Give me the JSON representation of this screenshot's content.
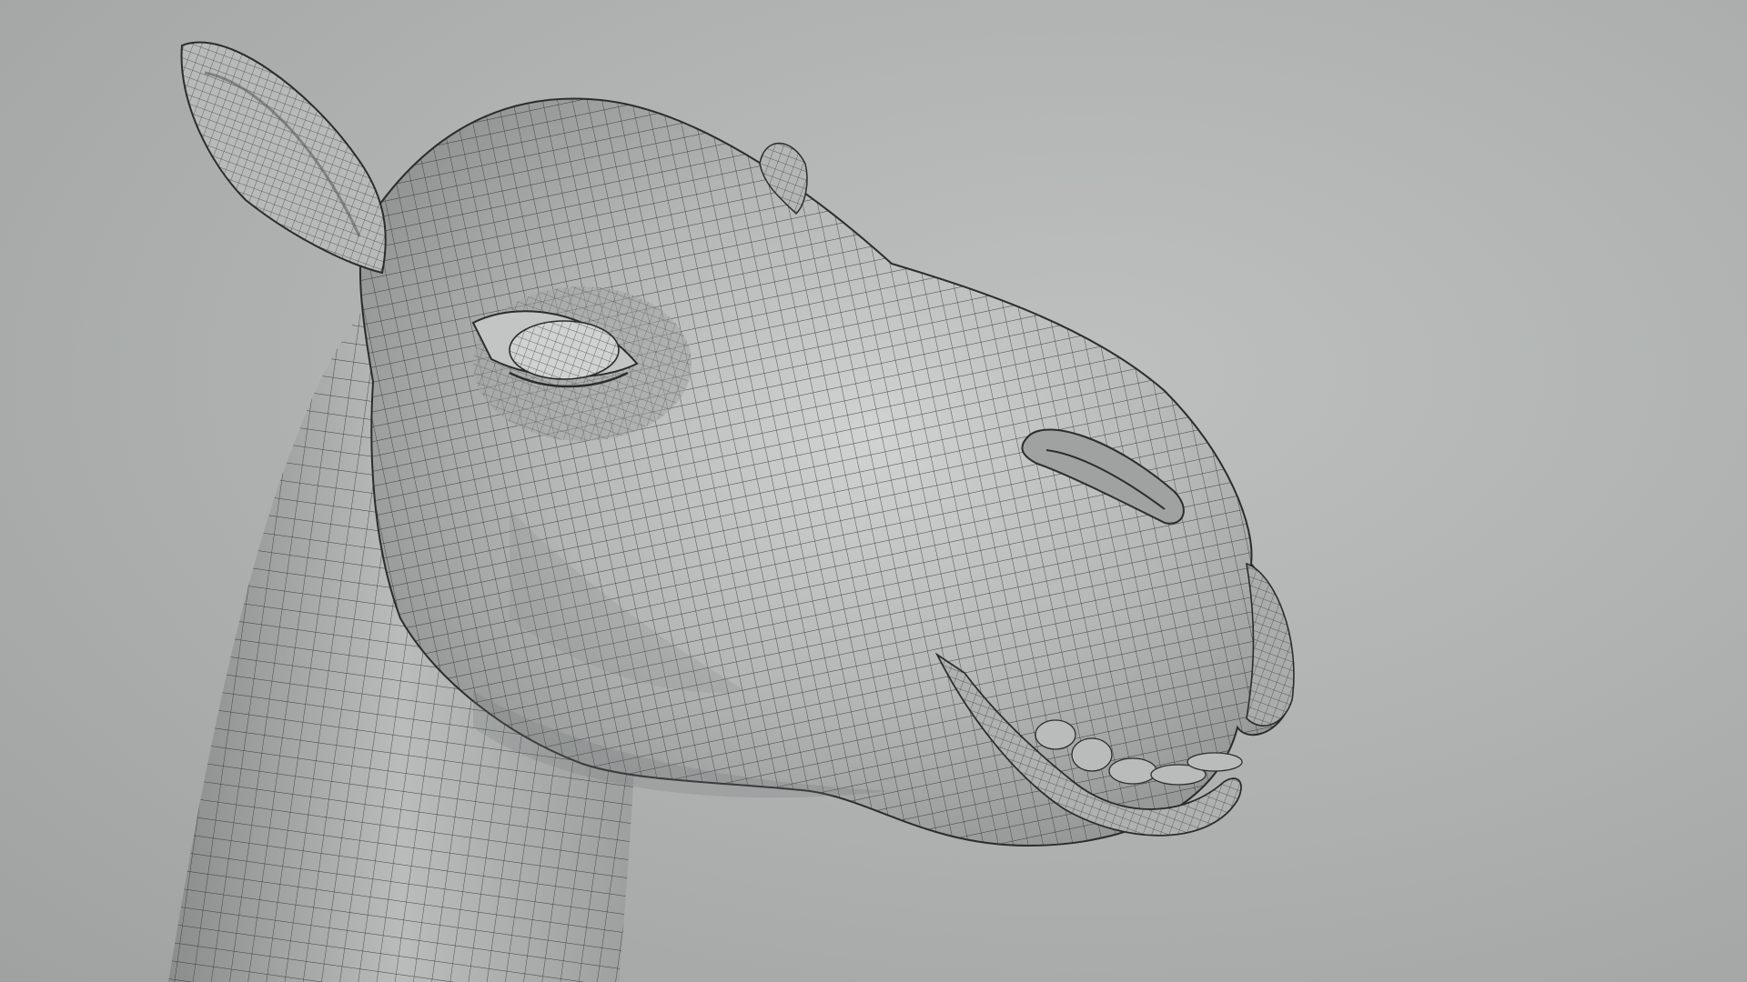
{
  "scene": {
    "subject": "camel-head-wireframe",
    "background_color": "#b0b3b2",
    "mesh_fill_color": "#a7aaa9",
    "mesh_highlight_color": "#d2d5d4",
    "wire_color": "#2b2d2d"
  }
}
